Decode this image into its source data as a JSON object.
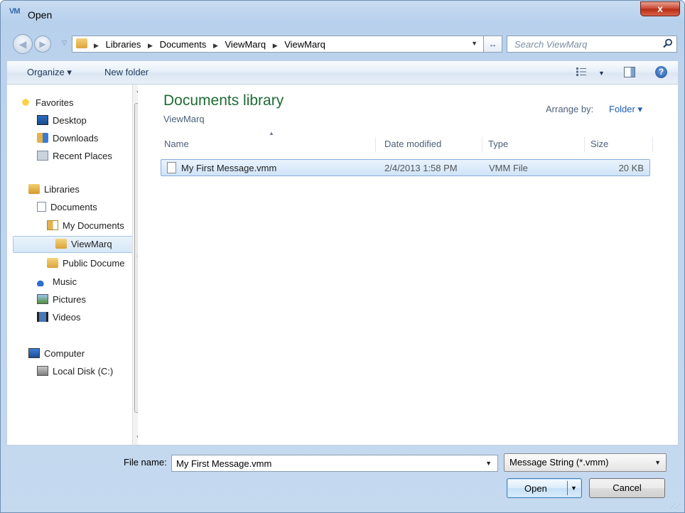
{
  "window": {
    "title": "Open",
    "app_icon_text": "VM",
    "close_glyph": "x"
  },
  "nav": {
    "breadcrumbs": [
      "Libraries",
      "Documents",
      "ViewMarq",
      "ViewMarq"
    ],
    "search_placeholder": "Search ViewMarq"
  },
  "toolbar": {
    "organize": "Organize ▾",
    "new_folder": "New folder"
  },
  "sidebar": {
    "items": [
      {
        "label": "Favorites",
        "icon": "star-icon"
      },
      {
        "label": "Desktop",
        "icon": "desktop-icon"
      },
      {
        "label": "Downloads",
        "icon": "downloads-folder-icon"
      },
      {
        "label": "Recent Places",
        "icon": "recent-places-icon"
      },
      {
        "label": "Libraries",
        "icon": "libraries-icon"
      },
      {
        "label": "Documents",
        "icon": "documents-icon"
      },
      {
        "label": "My Documents",
        "icon": "document-folder-icon"
      },
      {
        "label": "ViewMarq",
        "icon": "folder-icon",
        "selected": true
      },
      {
        "label": "Public Docume",
        "icon": "folder-icon"
      },
      {
        "label": "Music",
        "icon": "music-icon"
      },
      {
        "label": "Pictures",
        "icon": "pictures-icon"
      },
      {
        "label": "Videos",
        "icon": "videos-icon"
      },
      {
        "label": "Computer",
        "icon": "computer-icon"
      },
      {
        "label": "Local Disk (C:)",
        "icon": "disk-icon"
      }
    ]
  },
  "library": {
    "title": "Documents library",
    "subtitle": "ViewMarq",
    "arrange_label": "Arrange by:",
    "arrange_value": "Folder ▾"
  },
  "columns": [
    "Name",
    "Date modified",
    "Type",
    "Size"
  ],
  "files": [
    {
      "name": "My First Message.vmm",
      "date": "2/4/2013 1:58 PM",
      "type": "VMM File",
      "size": "20 KB"
    }
  ],
  "footer": {
    "file_name_label": "File name:",
    "file_name_value": "My First Message.vmm",
    "filter": "Message String (*.vmm)",
    "open": "Open",
    "cancel": "Cancel"
  },
  "colors": {
    "library_title": "#1d6b35",
    "link": "#1e5cb3",
    "selection": "#cfe3f8"
  }
}
